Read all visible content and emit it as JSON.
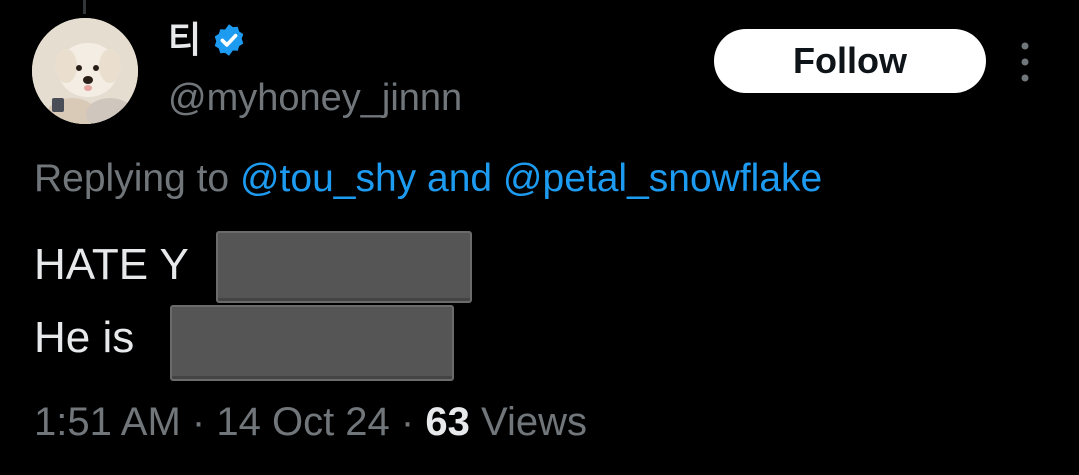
{
  "author": {
    "display_name": "티",
    "handle": "@myhoney_jinnn",
    "verified": true,
    "avatar_icon": "dog-photo-avatar"
  },
  "follow_button": {
    "label": "Follow"
  },
  "more_menu": {
    "icon": "more-vertical-icon"
  },
  "reply_context": {
    "prefix": "Replying to",
    "mention_1": "@tou_shy",
    "conjunction": "and",
    "mention_2": "@petal_snowflake"
  },
  "tweet": {
    "line_1": "HATE Y",
    "line_2": "He is"
  },
  "meta": {
    "time": "1:51 AM",
    "separator": "·",
    "date": "14 Oct 24",
    "views_count": "63",
    "views_label": "Views"
  },
  "colors": {
    "background": "#000000",
    "text_primary": "#e7e9ea",
    "text_secondary": "#71767b",
    "link": "#1d9bf0",
    "verified_badge": "#1d9bf0",
    "follow_bg": "#ffffff",
    "redaction": "#555555"
  }
}
